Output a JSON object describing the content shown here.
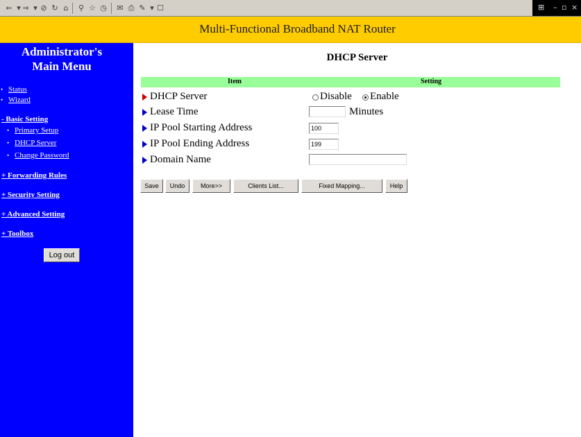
{
  "header": {
    "title": "Multi-Functional Broadband NAT Router"
  },
  "sidebar": {
    "title_line1": "Administrator's",
    "title_line2": "Main Menu",
    "links": {
      "status": "Status",
      "wizard": "Wizard",
      "basic_setting": "- Basic Setting",
      "primary_setup": "Primary Setup",
      "dhcp_server": "DHCP Server",
      "change_password": "Change Password",
      "forwarding_rules": "+ Forwarding Rules",
      "security_setting": "+ Security Setting",
      "advanced_setting": "+ Advanced Setting",
      "toolbox": "+ Toolbox"
    },
    "logout_label": "Log out"
  },
  "main": {
    "title": "DHCP Server",
    "table_header": {
      "item": "Item",
      "setting": "Setting"
    },
    "rows": {
      "dhcp_server": "DHCP Server",
      "lease_time": "Lease Time",
      "pool_start": "IP Pool Starting Address",
      "pool_end": "IP Pool Ending Address",
      "domain_name": "Domain Name"
    },
    "dhcp_options": {
      "disable": "Disable",
      "enable": "Enable",
      "selected": "Enable"
    },
    "lease_time_value": "",
    "lease_time_unit": "Minutes",
    "pool_start_value": "100",
    "pool_end_value": "199",
    "domain_name_value": ""
  },
  "buttons": {
    "save": "Save",
    "undo": "Undo",
    "more": "More>>",
    "clients_list": "Clients List...",
    "fixed_mapping": "Fixed Mapping...",
    "help": "Help"
  },
  "colors": {
    "header_bg": "#ffcc00",
    "sidebar_bg": "#0000ff",
    "table_header_bg": "#99ff99"
  }
}
